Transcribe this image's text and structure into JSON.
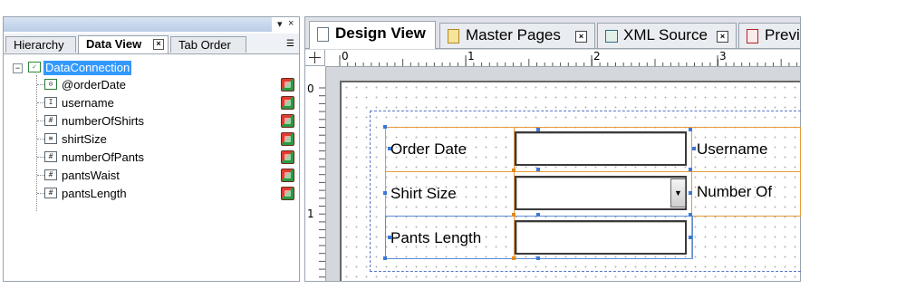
{
  "left_panel": {
    "title_controls": [
      "▾",
      "×"
    ],
    "tabs": [
      {
        "label": "Hierarchy",
        "active": false
      },
      {
        "label": "Data View",
        "active": true
      },
      {
        "label": "Tab Order",
        "active": false
      }
    ],
    "tree": {
      "root": "DataConnection",
      "fields": [
        {
          "name": "@orderDate",
          "icon": "date-field-icon",
          "glyph": "⊙"
        },
        {
          "name": "username",
          "icon": "text-field-icon",
          "glyph": "I"
        },
        {
          "name": "numberOfShirts",
          "icon": "numeric-field-icon",
          "glyph": "#"
        },
        {
          "name": "shirtSize",
          "icon": "dropdown-field-icon",
          "glyph": "≡"
        },
        {
          "name": "numberOfPants",
          "icon": "numeric-field-icon",
          "glyph": "#"
        },
        {
          "name": "pantsWaist",
          "icon": "numeric-field-icon",
          "glyph": "#"
        },
        {
          "name": "pantsLength",
          "icon": "numeric-field-icon",
          "glyph": "#"
        }
      ]
    }
  },
  "editor": {
    "tabs": [
      {
        "label": "Design View",
        "icon": "page-icon",
        "active": true
      },
      {
        "label": "Master Pages",
        "icon": "master-page-icon",
        "active": false
      },
      {
        "label": "XML Source",
        "icon": "xml-icon",
        "active": false
      },
      {
        "label": "Previe",
        "icon": "pdf-icon",
        "active": false
      }
    ],
    "ruler_h": [
      "0",
      "1",
      "2",
      "3"
    ],
    "ruler_v": [
      "0",
      "1"
    ],
    "form": {
      "labels": {
        "order_date": "Order Date",
        "shirt_size": "Shirt Size",
        "pants_length": "Pants Length",
        "username": "Username",
        "number_of": "Number Of"
      },
      "dropdown_arrow": "▼"
    }
  },
  "colors": {
    "selection": "#3399ff",
    "row_frame": "#e69a3a",
    "handle": "#3a78d6"
  }
}
